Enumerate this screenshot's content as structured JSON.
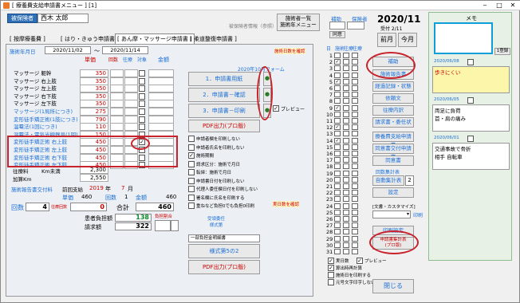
{
  "window": {
    "title": "[ 療養費支給申請書メニュー ] [1]"
  },
  "header": {
    "patient_label": "被保険者",
    "patient_name": "西木 太郎",
    "info_btn": "被保険者情報（参照）",
    "switch_btn": "施術者一覧\n施術年メニュー",
    "col_payer_a": "補助",
    "col_payer_b": "保険者",
    "payer_val": "同意",
    "month": "2020/11",
    "month_sub": "受付 2/11",
    "prev_btn": "前月",
    "this_btn": "今月"
  },
  "tabs": [
    "[ 按摩療養費 ]",
    "[ はり・きゅう申請書 ]",
    "[ あん摩・マッサージ申請書 ]",
    "[ 柔道整復申請書 ]"
  ],
  "form": {
    "period_label": "施術年月日",
    "period_from": "2020/11/02",
    "period_sep": "〜",
    "period_to": "2020/11/14",
    "col_price": "単価",
    "col_times": "回数",
    "col_out": "往療",
    "col_check": "対象",
    "col_amount": "金額",
    "items": [
      {
        "label": "マッサージ 躯幹",
        "price": "350"
      },
      {
        "label": "マッサージ 右上肢",
        "price": "350"
      },
      {
        "label": "マッサージ 左上肢",
        "price": "350"
      },
      {
        "label": "マッサージ 右下肢",
        "price": "350"
      },
      {
        "label": "マッサージ 左下肢",
        "price": "350"
      },
      {
        "label": "マッサージ(1局所につき)",
        "price": "275"
      },
      {
        "label": "変形徒手矯正術(1肢につき)",
        "price": "790"
      },
      {
        "label": "温罨法(1回につき)",
        "price": "110"
      },
      {
        "label": "温罨法・電気光線器具(1回)",
        "price": "150"
      },
      {
        "label": "変形徒手矯正術 右上肢",
        "price": "450"
      },
      {
        "label": "変形徒手矯正術 左上肢",
        "price": "450"
      },
      {
        "label": "変形徒手矯正術 右下肢",
        "price": "450"
      },
      {
        "label": "変形徒手矯正術 左下肢",
        "price": "450"
      }
    ],
    "travel_label": "往療料",
    "travel_km": "Km未満",
    "travel_val": "2,300",
    "extra_label": "加算Km",
    "extra_val": "2,550",
    "doc_label": "施術報告書交付料",
    "doc_period": "前回支給",
    "doc_year": "2019",
    "doc_year_u": "年",
    "doc_month": "7",
    "doc_month_u": "月",
    "unit_label": "単価",
    "unit_val": "460",
    "cnt_label": "回数",
    "cnt_val": "1",
    "amt_label": "金額",
    "amt_val": "460",
    "days_label": "回数",
    "days_val": "4",
    "days_sub": "往療回数",
    "zero_val": "0",
    "total_label": "合計",
    "total_val": "460",
    "burden_label": "患者負担額",
    "burden_val": "138",
    "claim_label": "請求額",
    "claim_val": "322",
    "rate_label": "負担割合",
    "rate_btn": "受領委任\n様式第",
    "print_note": "2020年10月フォーム",
    "btn_paper": "1．申請書用紙",
    "btn_confirm": "2．申請書－確認",
    "btn_print": "3．申請書－印刷",
    "btn_pdf": "PDF出力(プロ版)",
    "preview": "プレビュー",
    "opts": [
      "申請者欄を印刷しない",
      "申請者氏名を印刷しない",
      "施術期間",
      "請求区分：施術で月日",
      "転帰：施術で月日",
      "申請書日付を印刷しない",
      "代理人委任欄日付を印刷しない",
      "署名欄に氏名を印刷する",
      "重ねなど負担0でも負担0印刷"
    ],
    "select_val": "一部負担金明細書",
    "btn_form5": "様式第5の2",
    "btn_pdf2": "PDF出力(プロ版)",
    "red_note1": "施術日数を確認",
    "red_note2": "実日数を確認"
  },
  "calendar": {
    "heads": [
      "日",
      "施術",
      "往療",
      "往療"
    ],
    "days": [
      1,
      2,
      3,
      4,
      5,
      6,
      7,
      8,
      9,
      10,
      11,
      12,
      13,
      14,
      15,
      16,
      17,
      18,
      19,
      20,
      21,
      22,
      23,
      24,
      25,
      26,
      27,
      28,
      29,
      30,
      31
    ],
    "checked": [
      2,
      5,
      9,
      12,
      14
    ],
    "opts": [
      "実日数",
      "プレビュー",
      "算出時再計算",
      "施術日を印刷する",
      "元号文字印字しない"
    ]
  },
  "right": {
    "b1": "補助",
    "b2": "施術報告書",
    "b3": "経過記録・状態",
    "b4": "依頼文",
    "b5": "往療内訳",
    "b6": "請求書・委任状",
    "b7": "療養費支給申請書",
    "b8": "同意書交付申請書",
    "b9": "同意書",
    "sec_label": "回数集計表",
    "b10": "自動集計表",
    "b10_val": "2",
    "b11": "設定",
    "custom_label": "[文書・カスタマイズ]",
    "print_btn": "印刷",
    "b12": "印刷設定",
    "b13": "申請書集計表\n(プロ版)",
    "close_btn": "閉じる"
  },
  "memo": {
    "title": "メモ",
    "top_btn": "1登録",
    "notes": [
      {
        "date": "2020/06/08",
        "text": "歩きにくい",
        "yellow": true
      },
      {
        "date": "2020/06/05",
        "text": "両足に負荷\n首・肩の痛み",
        "yellow": false
      },
      {
        "date": "2020/06/01",
        "text": "交通事故で骨折\n相手 自転車",
        "yellow": false
      }
    ]
  }
}
